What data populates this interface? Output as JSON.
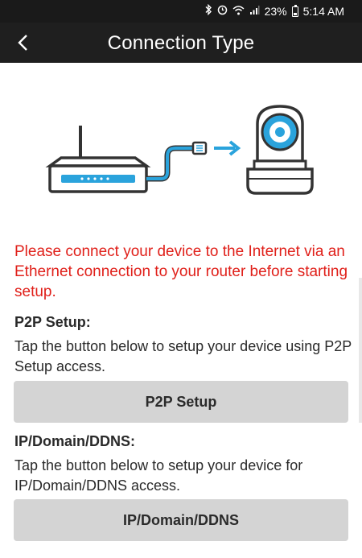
{
  "status_bar": {
    "left_text": "",
    "battery": "23%",
    "time": "5:14 AM",
    "icons": [
      "bluetooth-icon",
      "alarm-icon",
      "wifi-icon",
      "signal-icon",
      "battery-icon"
    ]
  },
  "app_bar": {
    "title": "Connection Type",
    "back_icon": "chevron-left-icon"
  },
  "illustration": {
    "items": [
      "router-icon",
      "ethernet-cable-icon",
      "arrow-right-icon",
      "camera-icon"
    ],
    "accent_color": "#2aa3dc"
  },
  "warning_text": "Please connect your device to the Internet via an Ethernet connection to your router before starting setup.",
  "p2p": {
    "title": "P2P Setup:",
    "description": "Tap the button below to setup your device using P2P Setup access.",
    "button_label": "P2P Setup"
  },
  "ip": {
    "title": "IP/Domain/DDNS:",
    "description": "Tap the button below to setup your device for IP/Domain/DDNS access.",
    "button_label": "IP/Domain/DDNS"
  },
  "colors": {
    "warning": "#e0201a",
    "button_bg": "#d4d4d4",
    "header_bg": "#1f1f1f"
  }
}
